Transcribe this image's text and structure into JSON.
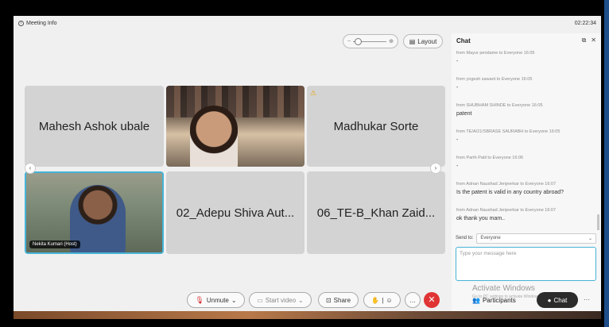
{
  "topbar": {
    "meeting_info": "Meeting Info",
    "clock": "02:22:34"
  },
  "controls": {
    "layout_label": "Layout"
  },
  "tiles": [
    {
      "name": "Mahesh Ashok ubale"
    },
    {
      "name": ""
    },
    {
      "name": "Madhukar Sorte"
    },
    {
      "name": "Nekita Kumari (Host)"
    },
    {
      "name": "02_Adepu Shiva Aut..."
    },
    {
      "name": "06_TE-B_Khan Zaid..."
    }
  ],
  "chat": {
    "title": "Chat",
    "messages": [
      {
        "meta": "from Mayur pendame to Everyone   16:05",
        "text": "-"
      },
      {
        "meta": "from yogesh sawant to Everyone   16:05",
        "text": "-"
      },
      {
        "meta": "from SHUBHAM SHINDE to Everyone   16:05",
        "text": "patent"
      },
      {
        "meta": "from TE/A/21/SBRASE SAURABH to Everyone   16:05",
        "text": "-"
      },
      {
        "meta": "from Parth Patil to Everyone   16:06",
        "text": "-"
      },
      {
        "meta": "from Adnan Naushad Jenjeerkar to Everyone   16:07",
        "text": "Is the patent is valid in any country abroad?"
      },
      {
        "meta": "from Adnan Naushad Jenjeerkar to Everyone   16:07",
        "text": "ok thank you mam.."
      }
    ],
    "send_to_label": "Send to:",
    "send_to_value": "Everyone",
    "input_placeholder": "Type your message here",
    "activate_title": "Activate Windows",
    "activate_sub": "Go to PC settings to activate Windows."
  },
  "toolbar": {
    "unmute": "Unmute",
    "start_video": "Start video",
    "share": "Share",
    "participants": "Participants",
    "chat": "Chat"
  },
  "colors": {
    "accent": "#46b3d6",
    "leave": "#e03434"
  }
}
